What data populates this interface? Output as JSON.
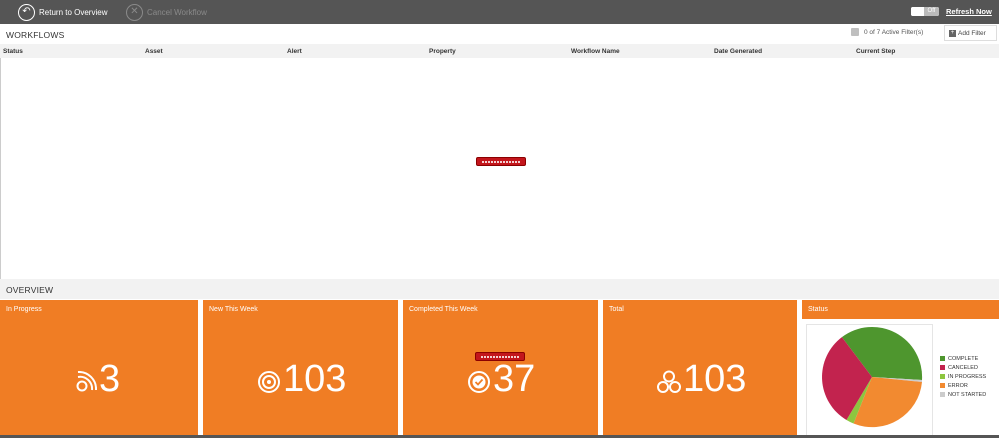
{
  "toolbar": {
    "return_label": "Return to Overview",
    "cancel_label": "Cancel Workflow",
    "toggle_text": "Off",
    "refresh_label": "Refresh Now"
  },
  "workflows": {
    "title": "WORKFLOWS",
    "filter_status": "0 of 7 Active Filter(s)",
    "add_filter_label": "Add Filter",
    "columns": [
      "Status",
      "Asset",
      "Alert",
      "Property",
      "Workflow Name",
      "Date Generated",
      "Current Step"
    ]
  },
  "overview": {
    "title": "OVERVIEW",
    "tiles": [
      {
        "label": "In Progress",
        "value": "3",
        "icon": "signal-icon"
      },
      {
        "label": "New This Week",
        "value": "103",
        "icon": "target-icon"
      },
      {
        "label": "Completed This Week",
        "value": "37",
        "icon": "check-circle-icon"
      },
      {
        "label": "Total",
        "value": "103",
        "icon": "cluster-icon"
      }
    ],
    "status": {
      "title": "Status",
      "legend": [
        {
          "label": "COMPLETE",
          "color": "#4e962e"
        },
        {
          "label": "CANCELED",
          "color": "#c2234e"
        },
        {
          "label": "IN PROGRESS",
          "color": "#8dc63f"
        },
        {
          "label": "ERROR",
          "color": "#f28a30"
        },
        {
          "label": "NOT STARTED",
          "color": "#cccccc"
        }
      ]
    }
  },
  "colors": {
    "toolbar_bg": "#555555",
    "accent_orange": "#f07d24",
    "loader_red": "#c3161c"
  }
}
